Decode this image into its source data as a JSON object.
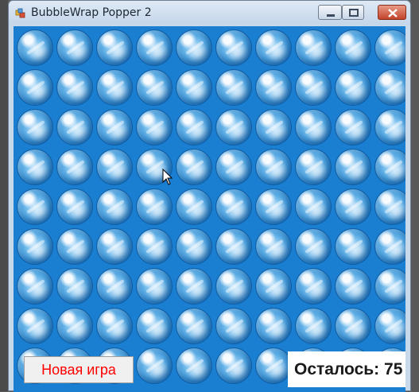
{
  "window": {
    "title": "BubbleWrap Popper 2"
  },
  "board": {
    "rows": 9,
    "cols": 10,
    "bubble_color": "#1a7fd1"
  },
  "controls": {
    "new_game_label": "Новая игра",
    "remaining_label": "Осталось: 75"
  },
  "colors": {
    "background": "#1a7fd1",
    "new_game_text": "#ff0000",
    "close_button": "#c2432a"
  },
  "icons": {
    "app": "app-icon",
    "minimize": "minimize-icon",
    "maximize": "maximize-icon",
    "close": "close-icon",
    "cursor": "mouse-cursor-icon"
  }
}
